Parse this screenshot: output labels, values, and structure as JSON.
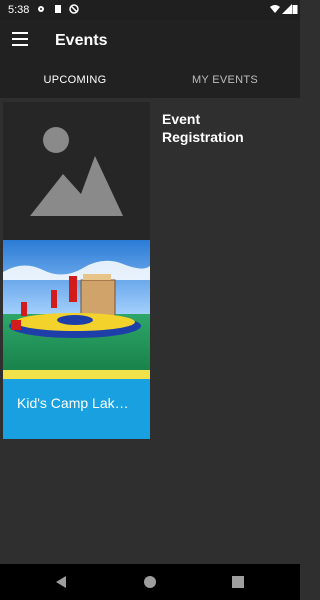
{
  "status": {
    "time": "5:38",
    "icons": [
      "gear-icon",
      "sd-card-icon",
      "no-disturb-icon",
      "wifi-icon",
      "signal-icon",
      "battery-icon"
    ]
  },
  "app_bar": {
    "title": "Events"
  },
  "tabs": [
    {
      "label": "UPCOMING",
      "active": true
    },
    {
      "label": "MY EVENTS",
      "active": false
    }
  ],
  "event": {
    "title": "Event Registration",
    "card_label": "Kid's Camp Lak…"
  },
  "colors": {
    "accent": "#7c4dff",
    "card_label_bg": "#19a0e0",
    "background": "#2f2f2f",
    "app_bar": "#212121"
  }
}
